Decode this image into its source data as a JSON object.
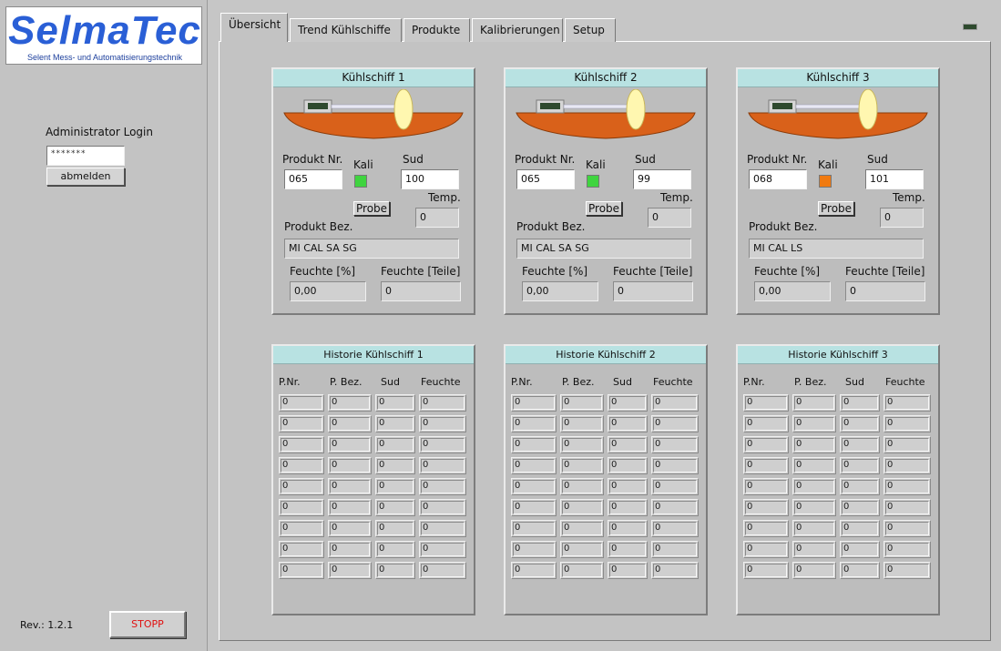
{
  "logo": {
    "brand": "SelmaTec",
    "subtitle": "Selent Mess- und Automatisierungstechnik"
  },
  "login": {
    "label": "Administrator Login",
    "password_mask": "*******",
    "logout_label": "abmelden"
  },
  "footer": {
    "revision": "Rev.: 1.2.1",
    "stop_label": "STOPP"
  },
  "tabs": [
    {
      "label": "Übersicht",
      "active": true
    },
    {
      "label": "Trend Kühlschiffe",
      "active": false
    },
    {
      "label": "Produkte",
      "active": false
    },
    {
      "label": "Kalibrierungen",
      "active": false
    },
    {
      "label": "Setup",
      "active": false
    }
  ],
  "labels": {
    "produkt_nr": "Produkt Nr.",
    "kali": "Kali",
    "sud": "Sud",
    "probe": "Probe",
    "temp": "Temp.",
    "produkt_bez": "Produkt Bez.",
    "feuchte_pct": "Feuchte [%]",
    "feuchte_teile": "Feuchte [Teile]"
  },
  "history_headers": [
    "P.Nr.",
    "P. Bez.",
    "Sud",
    "Feuchte"
  ],
  "colors": {
    "kali_green": "#3fd43f",
    "kali_orange": "#f07a10",
    "vessel_orange": "#d9611a",
    "title_cyan": "#b8e2e2"
  },
  "ships": [
    {
      "title": "Kühlschiff 1",
      "produkt_nr": "065",
      "sud": "100",
      "kali_status": "green",
      "temp": "0",
      "produkt_bez": "MI CAL SA SG",
      "feuchte_pct": "0,00",
      "feuchte_teile": "0",
      "history_title": "Historie Kühlschiff 1",
      "history_rows": [
        [
          "0",
          "0",
          "0",
          "0"
        ],
        [
          "0",
          "0",
          "0",
          "0"
        ],
        [
          "0",
          "0",
          "0",
          "0"
        ],
        [
          "0",
          "0",
          "0",
          "0"
        ],
        [
          "0",
          "0",
          "0",
          "0"
        ],
        [
          "0",
          "0",
          "0",
          "0"
        ],
        [
          "0",
          "0",
          "0",
          "0"
        ],
        [
          "0",
          "0",
          "0",
          "0"
        ],
        [
          "0",
          "0",
          "0",
          "0"
        ]
      ]
    },
    {
      "title": "Kühlschiff 2",
      "produkt_nr": "065",
      "sud": "99",
      "kali_status": "green",
      "temp": "0",
      "produkt_bez": "MI CAL SA SG",
      "feuchte_pct": "0,00",
      "feuchte_teile": "0",
      "history_title": "Historie Kühlschiff 2",
      "history_rows": [
        [
          "0",
          "0",
          "0",
          "0"
        ],
        [
          "0",
          "0",
          "0",
          "0"
        ],
        [
          "0",
          "0",
          "0",
          "0"
        ],
        [
          "0",
          "0",
          "0",
          "0"
        ],
        [
          "0",
          "0",
          "0",
          "0"
        ],
        [
          "0",
          "0",
          "0",
          "0"
        ],
        [
          "0",
          "0",
          "0",
          "0"
        ],
        [
          "0",
          "0",
          "0",
          "0"
        ],
        [
          "0",
          "0",
          "0",
          "0"
        ]
      ]
    },
    {
      "title": "Kühlschiff 3",
      "produkt_nr": "068",
      "sud": "101",
      "kali_status": "orange",
      "temp": "0",
      "produkt_bez": "MI CAL LS",
      "feuchte_pct": "0,00",
      "feuchte_teile": "0",
      "history_title": "Historie Kühlschiff 3",
      "history_rows": [
        [
          "0",
          "0",
          "0",
          "0"
        ],
        [
          "0",
          "0",
          "0",
          "0"
        ],
        [
          "0",
          "0",
          "0",
          "0"
        ],
        [
          "0",
          "0",
          "0",
          "0"
        ],
        [
          "0",
          "0",
          "0",
          "0"
        ],
        [
          "0",
          "0",
          "0",
          "0"
        ],
        [
          "0",
          "0",
          "0",
          "0"
        ],
        [
          "0",
          "0",
          "0",
          "0"
        ],
        [
          "0",
          "0",
          "0",
          "0"
        ]
      ]
    }
  ]
}
